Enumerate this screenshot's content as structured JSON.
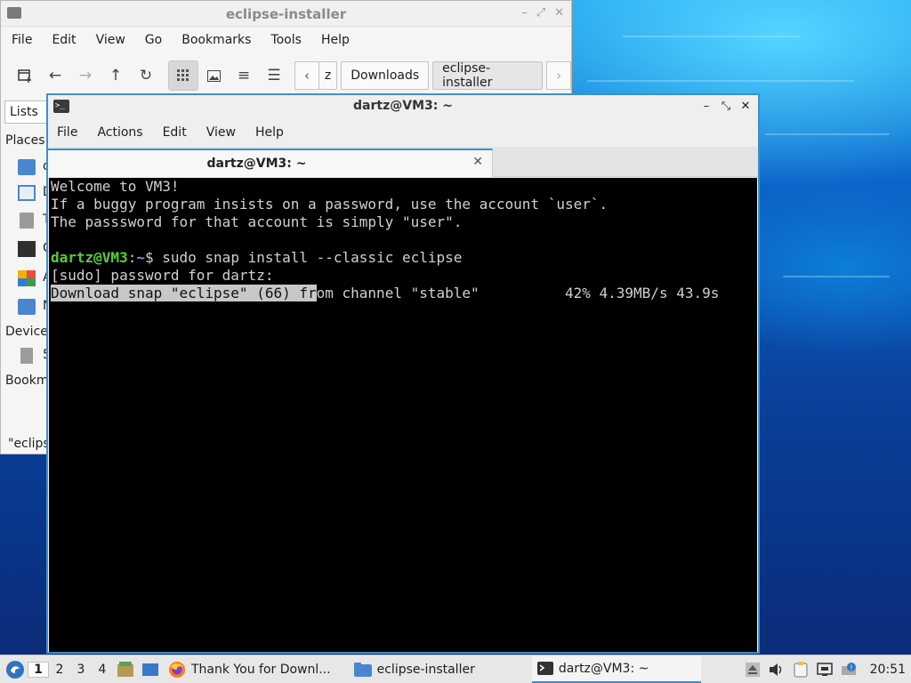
{
  "colors": {
    "accent": "#3f90c9",
    "prompt_user": "#54d12b",
    "prompt_path": "#6d9fd8",
    "terminal_bg": "#000000"
  },
  "file_manager": {
    "title": "eclipse-installer",
    "menu": [
      "File",
      "Edit",
      "View",
      "Go",
      "Bookmarks",
      "Tools",
      "Help"
    ],
    "toolbar_icons": [
      "new-tab-icon",
      "back-icon",
      "forward-icon",
      "up-icon",
      "reload-icon",
      "icon-view-icon",
      "thumbnail-view-icon",
      "compact-view-icon",
      "detailed-list-icon"
    ],
    "path_truncated": "z",
    "path": [
      "Downloads",
      "eclipse-installer"
    ],
    "side_tab": "Lists",
    "side_headings": {
      "places": "Places",
      "devices": "Device",
      "bookmarks": "Bookm"
    },
    "side_item_letters": [
      "d",
      "D",
      "T",
      "C",
      "A",
      "N"
    ],
    "device_letter": "5",
    "status_text": "\"eclips"
  },
  "terminal": {
    "title": "dartz@VM3: ~",
    "menu": [
      "File",
      "Actions",
      "Edit",
      "View",
      "Help"
    ],
    "tab_label": "dartz@VM3: ~",
    "lines": {
      "welcome": "Welcome to VM3!",
      "hint1": "If a buggy program insists on a password, use the account `user`.",
      "hint2": "The passsword for that account is simply \"user\".",
      "prompt_user": "dartz@VM3",
      "prompt_sep": ":",
      "prompt_path": "~",
      "prompt_cmd": "$ sudo snap install --classic eclipse",
      "sudo": "[sudo] password for dartz:",
      "download_sel": "Download snap \"eclipse\" (66) fr",
      "download_rest": "om channel \"stable\"          42% 4.39MB/s 43.9s"
    }
  },
  "taskbar": {
    "workspaces": [
      "1",
      "2",
      "3",
      "4"
    ],
    "tasks": [
      {
        "label": "Thank You for Downl...",
        "icon": "firefox-icon"
      },
      {
        "label": "eclipse-installer",
        "icon": "folder-icon"
      },
      {
        "label": "dartz@VM3: ~",
        "icon": "terminal-icon"
      }
    ],
    "clock": "20:51"
  }
}
